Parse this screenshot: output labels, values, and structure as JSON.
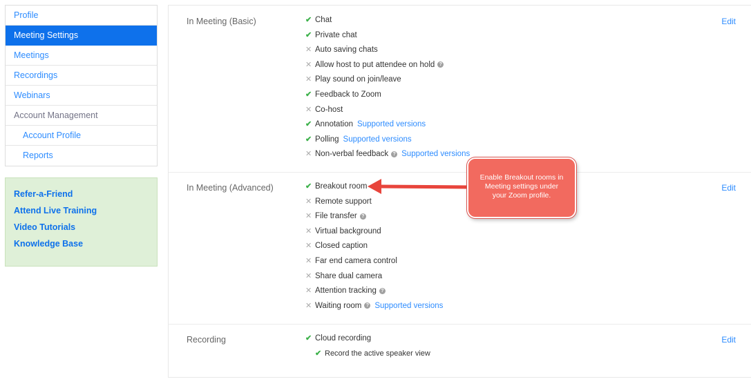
{
  "sidebar": {
    "nav": [
      {
        "label": "Profile",
        "kind": "link"
      },
      {
        "label": "Meeting Settings",
        "kind": "active"
      },
      {
        "label": "Meetings",
        "kind": "link"
      },
      {
        "label": "Recordings",
        "kind": "link"
      },
      {
        "label": "Webinars",
        "kind": "link"
      },
      {
        "label": "Account Management",
        "kind": "section"
      },
      {
        "label": "Account Profile",
        "kind": "sub"
      },
      {
        "label": "Reports",
        "kind": "sub"
      }
    ],
    "help_links": [
      "Refer-a-Friend",
      "Attend Live Training",
      "Video Tutorials",
      "Knowledge Base"
    ]
  },
  "groups": [
    {
      "title": "In Meeting (Basic)",
      "edit": "Edit",
      "items": [
        {
          "label": "Chat",
          "enabled": true
        },
        {
          "label": "Private chat",
          "enabled": true
        },
        {
          "label": "Auto saving chats",
          "enabled": false
        },
        {
          "label": "Allow host to put attendee on hold",
          "enabled": false,
          "info": true
        },
        {
          "label": "Play sound on join/leave",
          "enabled": false
        },
        {
          "label": "Feedback to Zoom",
          "enabled": true
        },
        {
          "label": "Co-host",
          "enabled": false
        },
        {
          "label": "Annotation",
          "enabled": true,
          "link": "Supported versions"
        },
        {
          "label": "Polling",
          "enabled": true,
          "link": "Supported versions"
        },
        {
          "label": "Non-verbal feedback",
          "enabled": false,
          "info": true,
          "link": "Supported versions"
        }
      ]
    },
    {
      "title": "In Meeting (Advanced)",
      "edit": "Edit",
      "items": [
        {
          "label": "Breakout room",
          "enabled": true
        },
        {
          "label": "Remote support",
          "enabled": false
        },
        {
          "label": "File transfer",
          "enabled": false,
          "info": true
        },
        {
          "label": "Virtual background",
          "enabled": false
        },
        {
          "label": "Closed caption",
          "enabled": false
        },
        {
          "label": "Far end camera control",
          "enabled": false
        },
        {
          "label": "Share dual camera",
          "enabled": false
        },
        {
          "label": "Attention tracking",
          "enabled": false,
          "info": true
        },
        {
          "label": "Waiting room",
          "enabled": false,
          "info": true,
          "link": "Supported versions"
        }
      ]
    },
    {
      "title": "Recording",
      "edit": "Edit",
      "items": [
        {
          "label": "Cloud recording",
          "enabled": true
        },
        {
          "label": "Record the active speaker view",
          "enabled": true,
          "sub": true
        }
      ]
    }
  ],
  "callout": {
    "lines": [
      "Enable Breakout rooms in",
      "Meeting settings under",
      "your Zoom profile."
    ]
  },
  "icons": {
    "check": "check-icon",
    "cross": "cross-icon",
    "info": "info-icon",
    "arrow": "arrow-left-icon"
  },
  "colors": {
    "accent": "#0e71eb",
    "link": "#2d8cff",
    "check": "#3cb14a",
    "callout": "#f26a5f",
    "arrow": "#e8453c",
    "help_bg": "#dff0d8"
  }
}
